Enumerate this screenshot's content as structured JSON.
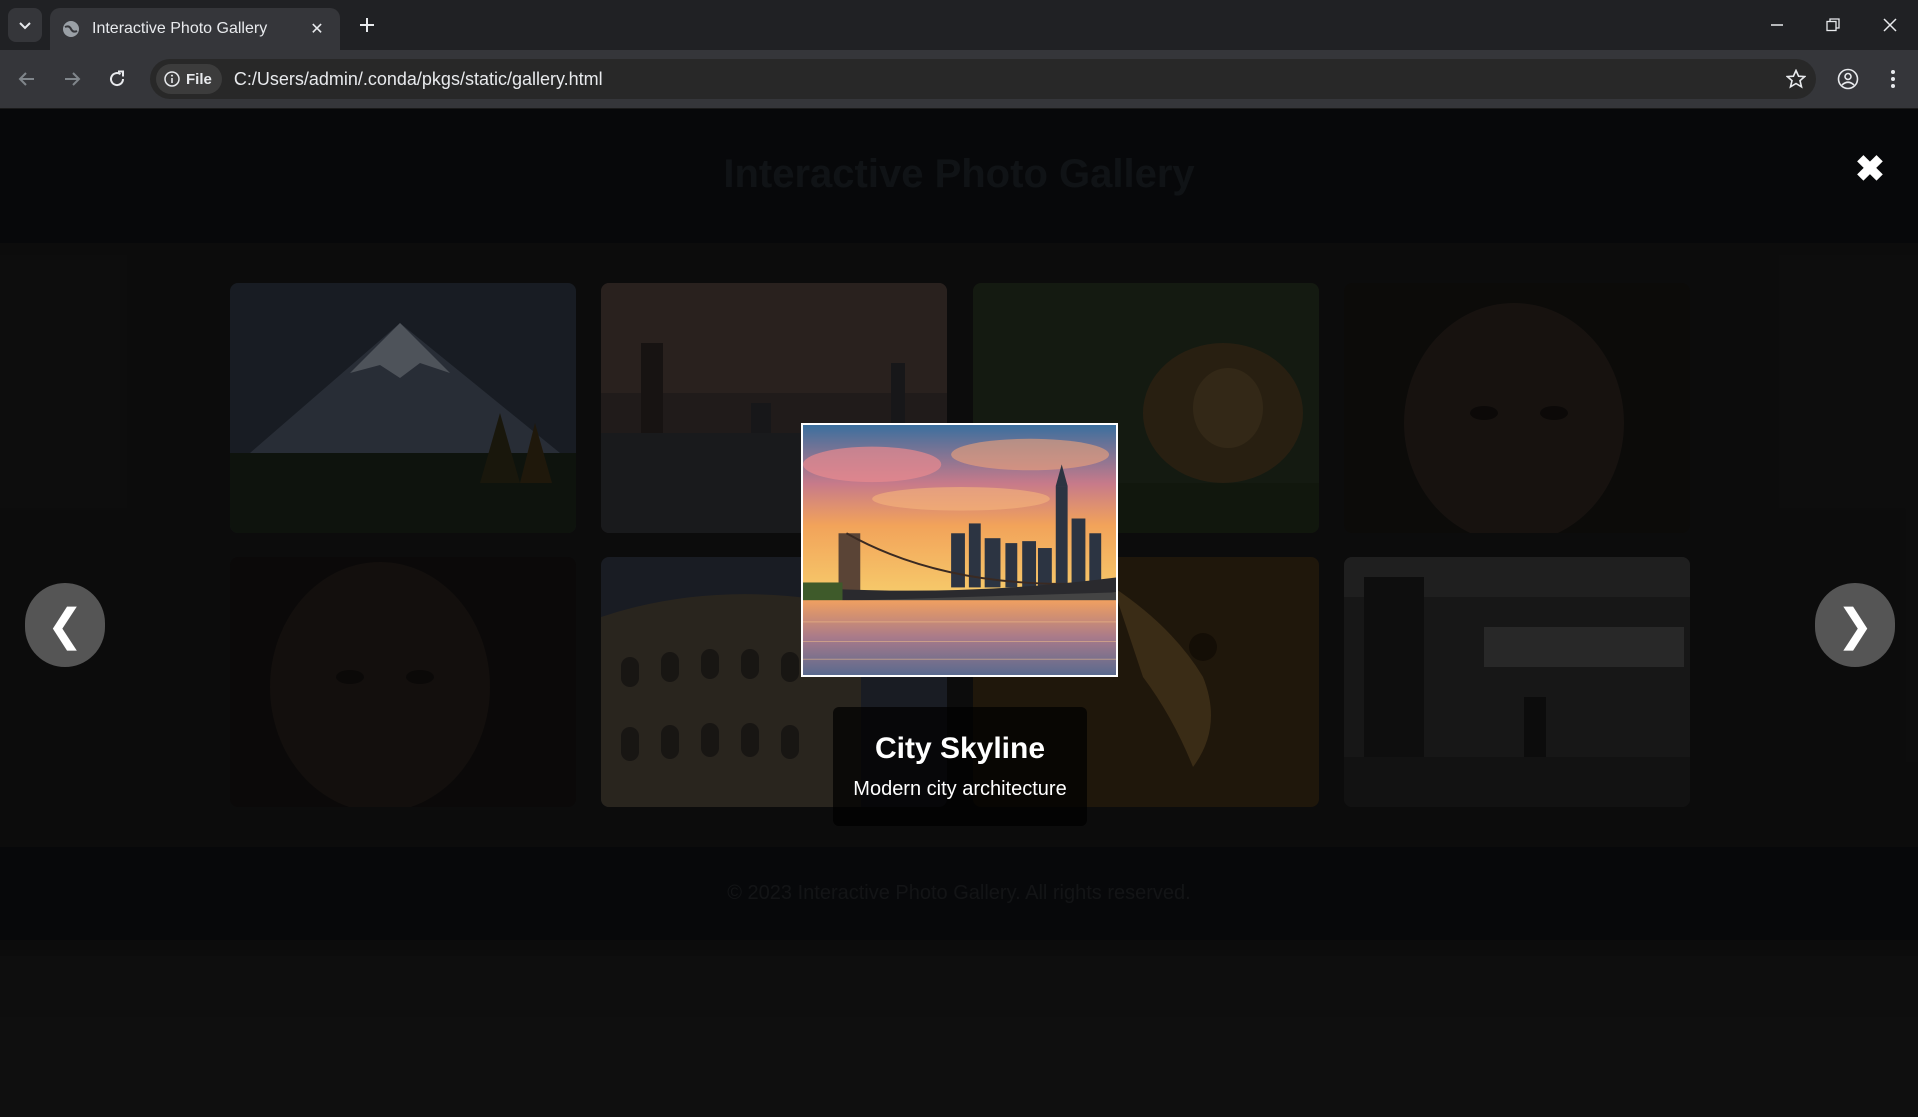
{
  "browser": {
    "tab_title": "Interactive Photo Gallery",
    "site_chip_label": "File",
    "url": "C:/Users/admin/.conda/pkgs/static/gallery.html"
  },
  "page": {
    "header_title": "Interactive Photo Gallery",
    "footer_text": "© 2023 Interactive Photo Gallery. All rights reserved."
  },
  "lightbox": {
    "close_glyph": "✖",
    "prev_glyph": "❮",
    "next_glyph": "❯",
    "caption_title": "City Skyline",
    "caption_description": "Modern city architecture"
  }
}
